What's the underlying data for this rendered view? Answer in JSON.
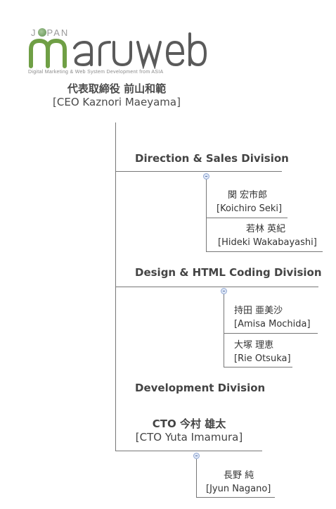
{
  "logo": {
    "japan_left": "J",
    "japan_right": "PAN",
    "wordmark": "maruweb",
    "tagline": "Digital Marketing & Web System Development from ASIA"
  },
  "ceo": {
    "name_jp": "代表取締役 前山和範",
    "name_en": "[CEO Kaznori Maeyama]"
  },
  "divisions": [
    {
      "title": "Direction & Sales Division",
      "members": [
        {
          "jp": "関 宏市郎",
          "en": "[Koichiro Seki]"
        },
        {
          "jp": "若林 英紀",
          "en": "[Hideki Wakabayashi]"
        }
      ]
    },
    {
      "title": "Design & HTML Coding Division",
      "members": [
        {
          "jp": "持田 亜美沙",
          "en": "[Amisa Mochida]"
        },
        {
          "jp": "大塚 理恵",
          "en": "[Rie Otsuka]"
        }
      ]
    },
    {
      "title": "Development Division",
      "head_jp": "CTO 今村 雄太",
      "head_en": "[CTO Yuta Imamura]",
      "members": [
        {
          "jp": "長野 純",
          "en": "[Jyun Nagano]"
        }
      ]
    }
  ],
  "colors": {
    "logo_green": "#6f9f45",
    "logo_gray": "#5a5a5a",
    "line": "#777777",
    "node_fill": "#dde6f6"
  }
}
